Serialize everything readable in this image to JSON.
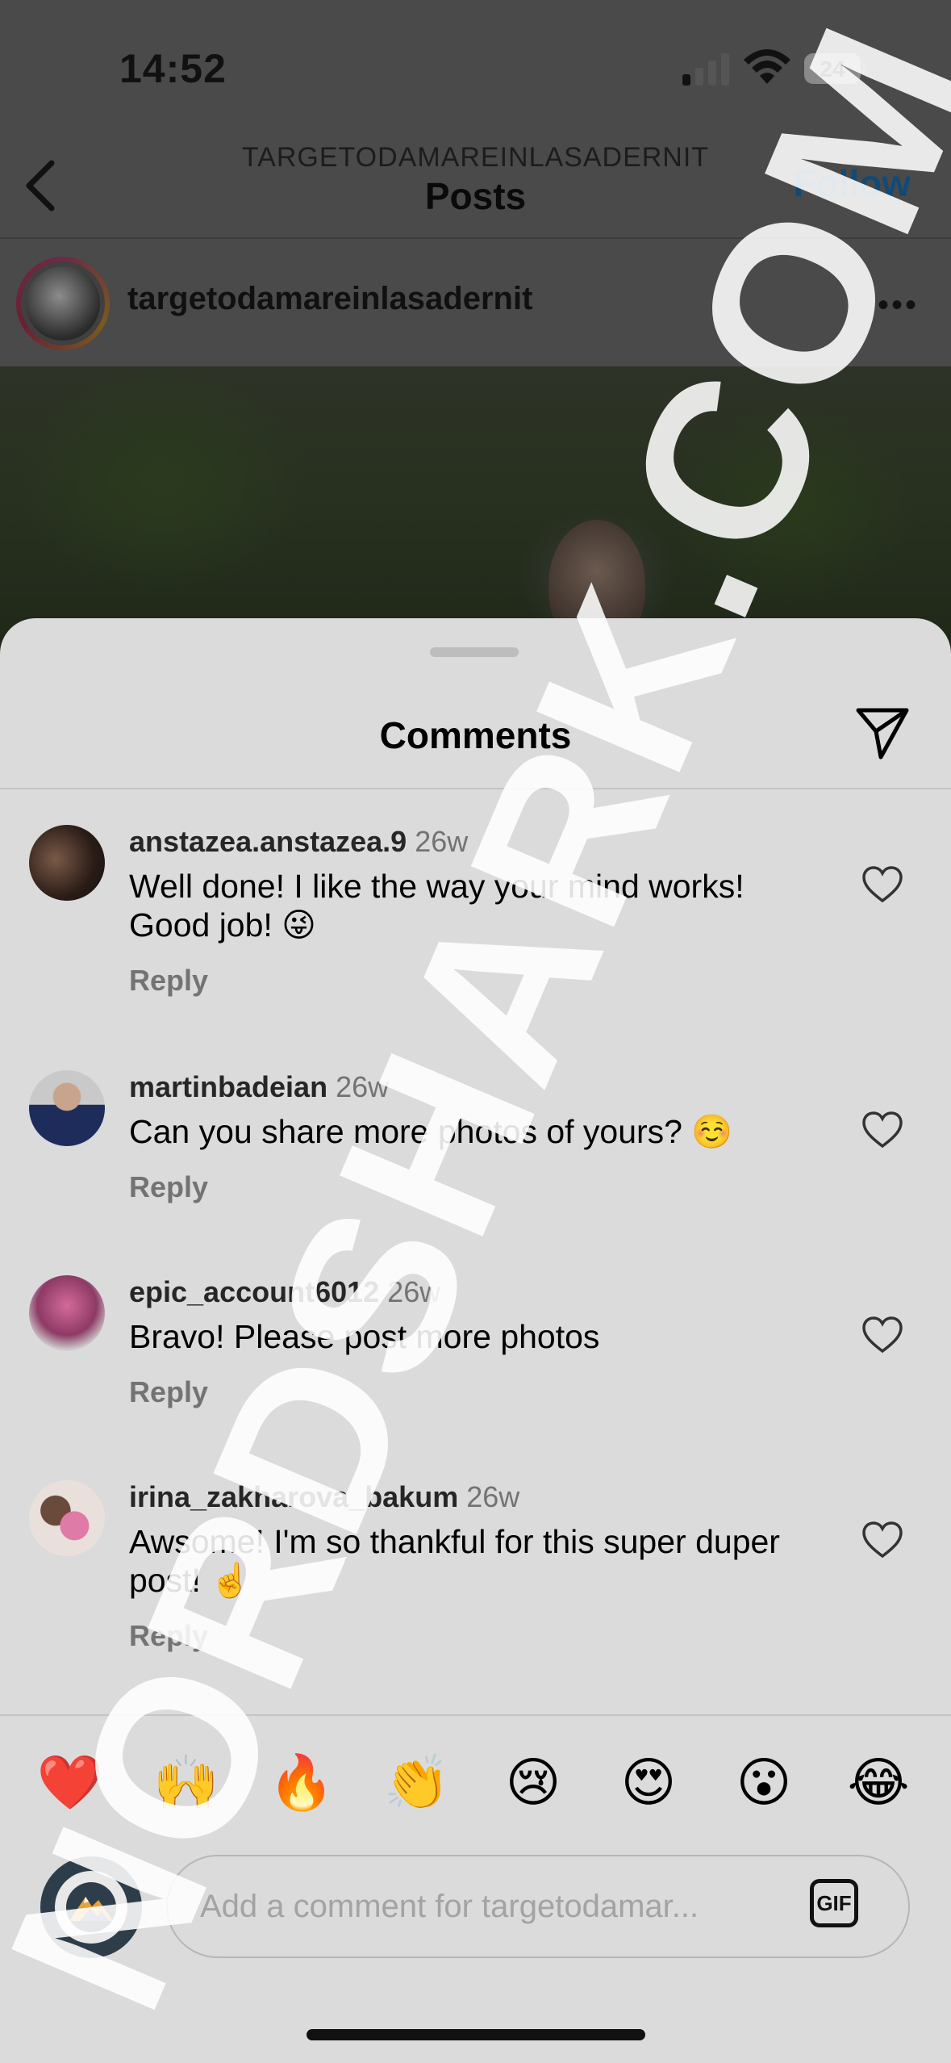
{
  "status_bar": {
    "time": "14:52",
    "battery": "24"
  },
  "header": {
    "account_upper": "TARGETODAMAREINLASADERNIT",
    "title": "Posts",
    "follow_label": "Follow"
  },
  "post": {
    "username": "targetodamareinlasadernit",
    "more": "•••"
  },
  "sheet": {
    "title": "Comments",
    "comments": [
      {
        "username": "anstazea.anstazea.9",
        "time": "26w",
        "text": "Well done! I like the way your mind works! Good job! 😜",
        "reply": "Reply"
      },
      {
        "username": "martinbadeian",
        "time": "26w",
        "text": "Can you share more photos of yours? ☺️",
        "reply": "Reply"
      },
      {
        "username": "epic_account6012",
        "time": "26w",
        "text": "Bravo! Please post more photos",
        "reply": "Reply"
      },
      {
        "username": "irina_zakharova_bakum",
        "time": "26w",
        "text": "Awsome! I'm so thankful for this super duper post! ☝️",
        "reply": "Reply"
      }
    ]
  },
  "quick_reactions": [
    "❤️",
    "🙌",
    "🔥",
    "👏",
    "😢",
    "😍",
    "😮",
    "😂"
  ],
  "composer": {
    "placeholder": "Add a comment for targetodamar...",
    "gif_label": "GIF"
  },
  "watermark": "NORDSHARK.COM",
  "colors": {
    "sheet_bg": "#dbdbdb",
    "follow": "#114a77",
    "muted": "#737373"
  }
}
